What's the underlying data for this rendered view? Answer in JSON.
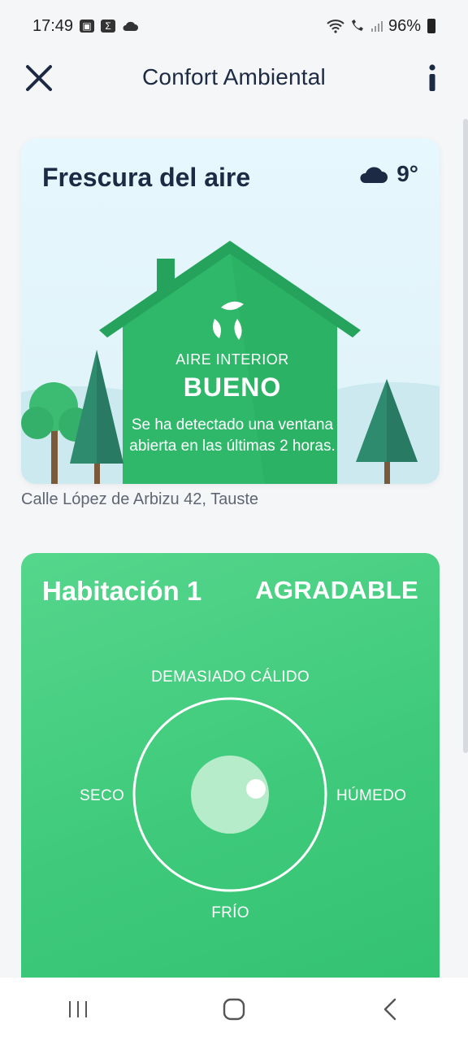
{
  "status_bar": {
    "time": "17:49",
    "battery": "96%",
    "icons": [
      "gallery-icon",
      "sigma-app-icon",
      "cloud-icon",
      "wifi-icon",
      "wifi-call-icon",
      "signal-icon",
      "battery-icon"
    ]
  },
  "app_bar": {
    "title": "Confort Ambiental",
    "close_icon": "close-icon",
    "info_icon": "info-icon"
  },
  "air_card": {
    "title": "Frescura del aire",
    "weather_icon": "cloud-icon",
    "temperature": "9°",
    "label": "AIRE INTERIOR",
    "status": "BUENO",
    "message": "Se ha detectado una ventana abierta en las últimas 2 horas.",
    "leaf_icon": "leaves-icon"
  },
  "address": "Calle López de Arbizu 42, Tauste",
  "room_card": {
    "title": "Habitación 1",
    "status": "AGRADABLE",
    "axis_top": "DEMASIADO CÁLIDO",
    "axis_bottom": "FRÍO",
    "axis_left": "SECO",
    "axis_right": "HÚMEDO"
  },
  "nav_bar": {
    "icons": [
      "recents-icon",
      "home-icon",
      "back-icon"
    ]
  },
  "colors": {
    "primary_text": "#1d2a44",
    "house_green": "#2fb86a",
    "roof_green": "#25a35c",
    "room_card_green": "#3fca7b",
    "tree_dark": "#2e8b6e"
  }
}
